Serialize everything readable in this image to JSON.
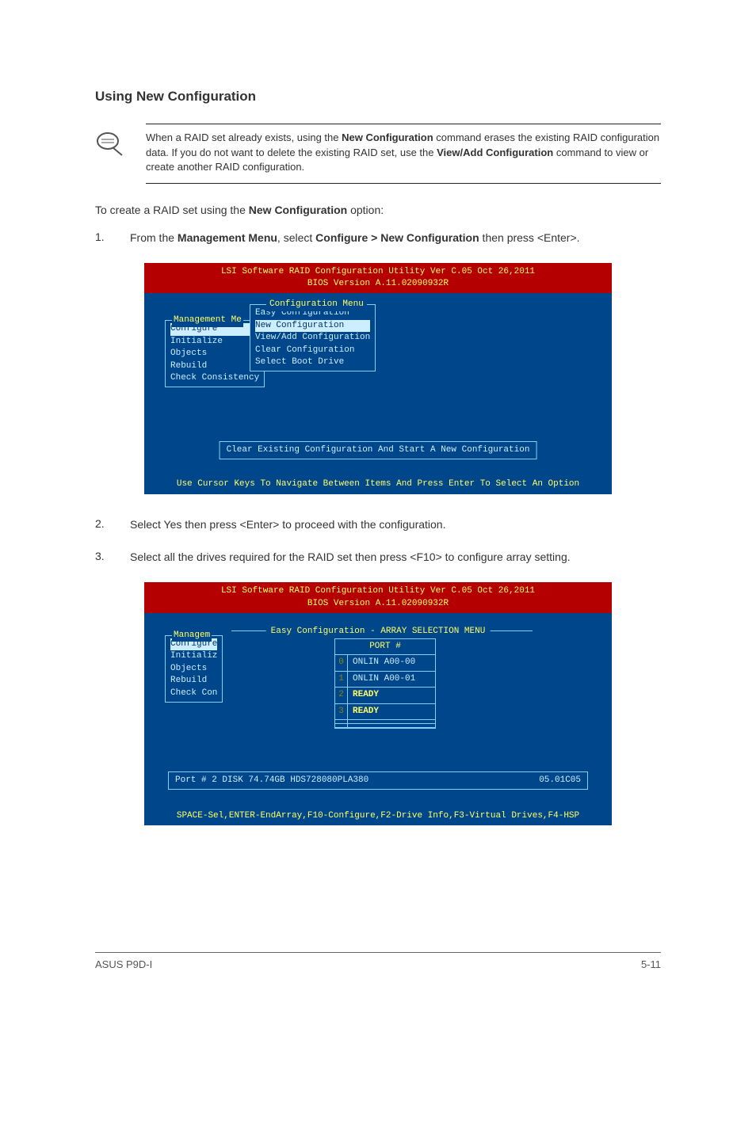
{
  "title": "Using New Configuration",
  "note": {
    "part1": "When a RAID set already exists, using the ",
    "bold1": "New Configuration",
    "part2": " command erases the existing RAID configuration data. If you do not want to delete the existing RAID set, use the ",
    "bold2": "View/Add Configuration",
    "part3": " command to view or create another RAID configuration."
  },
  "intro": {
    "part1": "To create a RAID set using the ",
    "bold1": "New Configuration",
    "part2": " option:"
  },
  "steps": {
    "s1": {
      "num": "1.",
      "t1": "From the ",
      "b1": "Management Menu",
      "t2": ", select ",
      "b2": "Configure > New Configuration",
      "t3": " then press <Enter>."
    },
    "s2": {
      "num": "2.",
      "t1": "Select Yes then press <Enter> to proceed with the configuration."
    },
    "s3": {
      "num": "3.",
      "t1": "Select all the drives required for the RAID set then press <F10> to configure array setting."
    }
  },
  "bios1": {
    "header_line1": "LSI Software RAID Configuration Utility Ver C.05 Oct 26,2011",
    "header_line2": "BIOS Version  A.11.02090932R",
    "left_title": "Management Me",
    "left_items": [
      "Configure",
      "Initialize",
      "Objects",
      "Rebuild",
      "Check Consistency"
    ],
    "cfg_title": "Configuration Menu",
    "cfg_items": [
      "Easy Configuration",
      "New Configuration",
      "View/Add Configuration",
      "Clear Configuration",
      "Select Boot Drive"
    ],
    "hint": "Clear Existing Configuration And Start A New Configuration",
    "footer": "Use Cursor Keys To Navigate Between Items And Press Enter To Select An Option"
  },
  "bios2": {
    "header_line1": "LSI Software RAID Configuration Utility Ver C.05 Oct 26,2011",
    "header_line2": "BIOS Version  A.11.02090932R",
    "left_title": "Managem",
    "left_items": [
      "Configure",
      "Initializ",
      "Objects",
      "Rebuild",
      "Check Con"
    ],
    "easy_title": "Easy Configuration - ARRAY SELECTION MENU",
    "port_header": "PORT #",
    "ports": [
      {
        "n": "0",
        "v": "ONLIN A00-00",
        "ready": false
      },
      {
        "n": "1",
        "v": "ONLIN A00-01",
        "ready": false
      },
      {
        "n": "2",
        "v": "READY",
        "ready": true
      },
      {
        "n": "3",
        "v": "READY",
        "ready": true
      },
      {
        "n": "",
        "v": "",
        "ready": false
      },
      {
        "n": "",
        "v": "",
        "ready": false
      }
    ],
    "port_info_left": "Port # 2 DISK  74.74GB HDS728080PLA380",
    "port_info_right": "05.01C05",
    "footer": "SPACE-Sel,ENTER-EndArray,F10-Configure,F2-Drive Info,F3-Virtual Drives,F4-HSP"
  },
  "footer": {
    "left": "ASUS P9D-I",
    "right": "5-11"
  }
}
